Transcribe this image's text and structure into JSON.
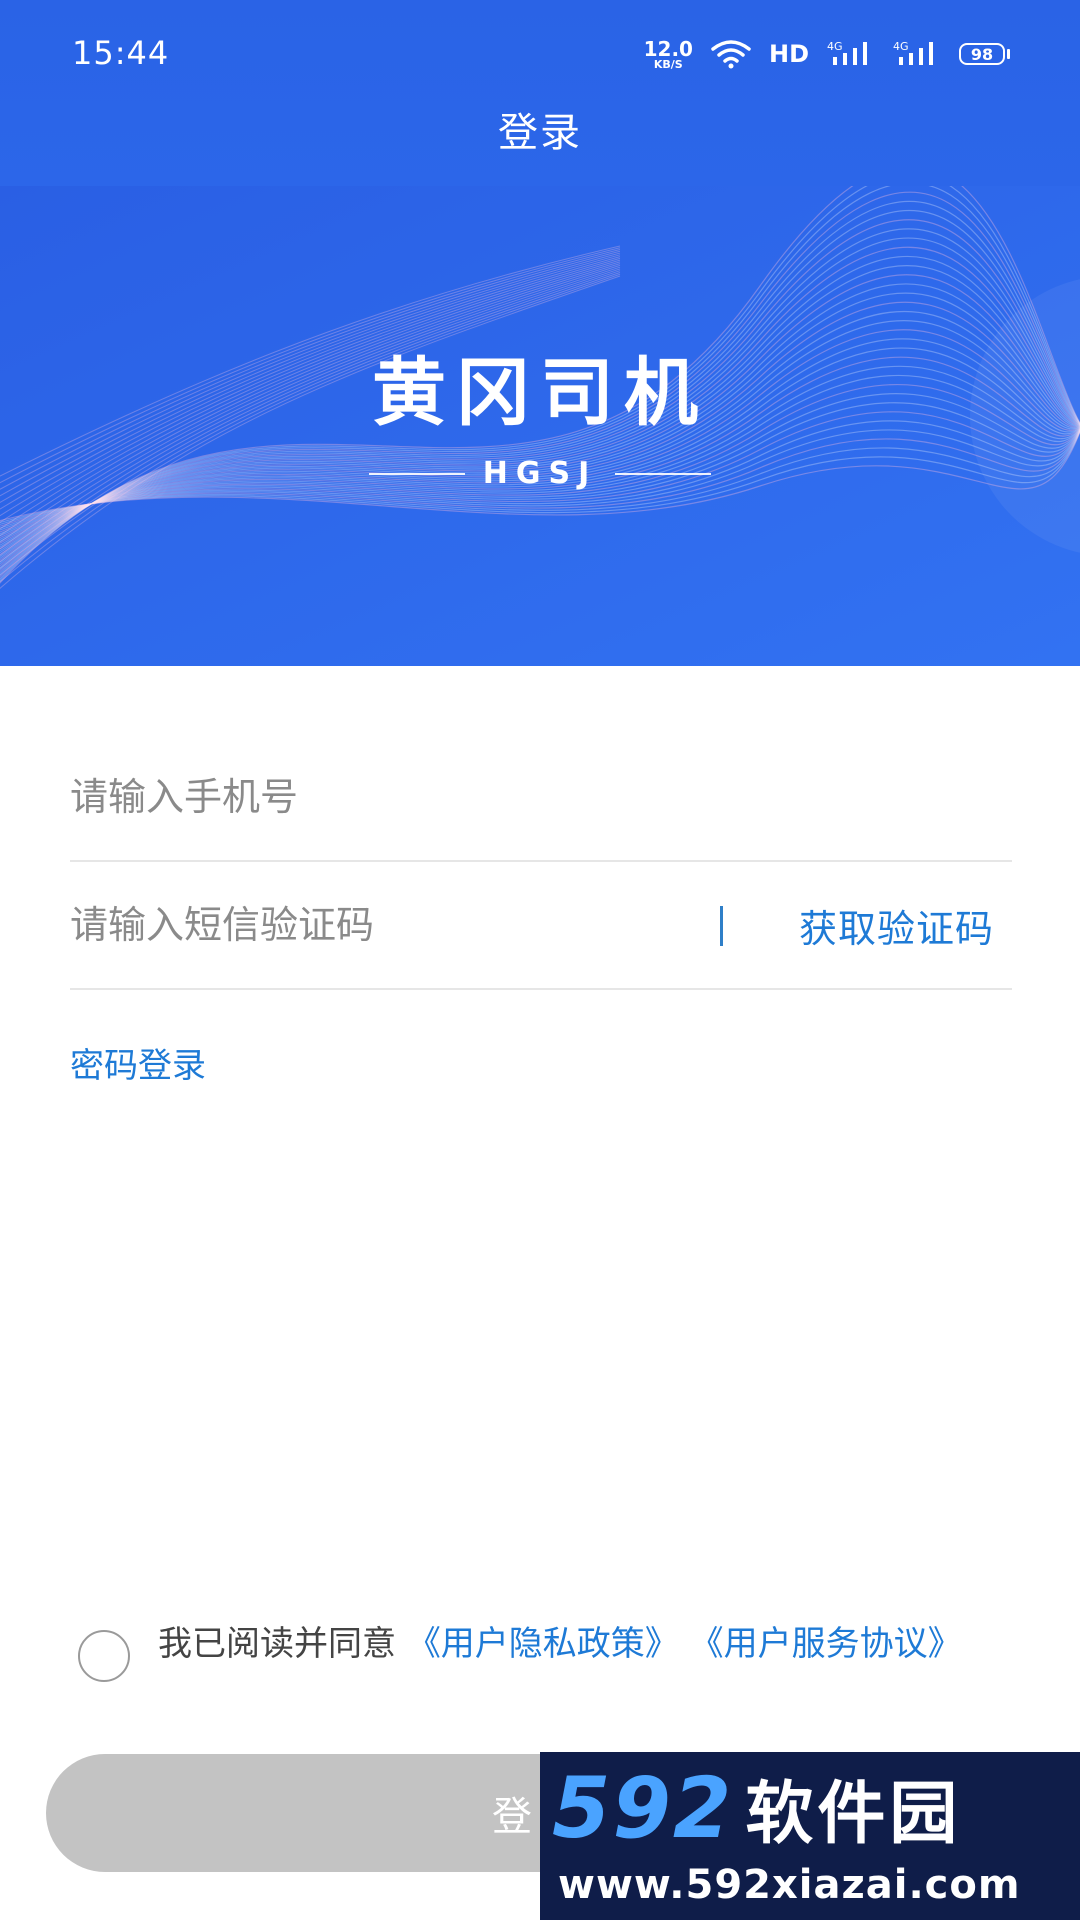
{
  "status_bar": {
    "time": "15:44",
    "net_speed_value": "12.0",
    "net_speed_unit": "KB/S",
    "hd_label": "HD",
    "network_1": "4G",
    "network_2": "4G",
    "battery": "98"
  },
  "header": {
    "title": "登录"
  },
  "banner": {
    "brand_name": "黄冈司机",
    "brand_sub": "HGSJ"
  },
  "form": {
    "phone_placeholder": "请输入手机号",
    "code_placeholder": "请输入短信验证码",
    "get_code_label": "获取验证码",
    "password_login_label": "密码登录"
  },
  "agreement": {
    "prefix": "我已阅读并同意",
    "privacy_link": "《用户隐私政策》",
    "service_link": "《用户服务协议》"
  },
  "login_button": {
    "label": "登录"
  },
  "watermark": {
    "number": "592",
    "name": "软件园",
    "url": "www.592xiazai.com"
  },
  "colors": {
    "primary_blue": "#2c67ea",
    "link_blue": "#1e7ad6",
    "disabled_button": "#c3c3c3"
  }
}
